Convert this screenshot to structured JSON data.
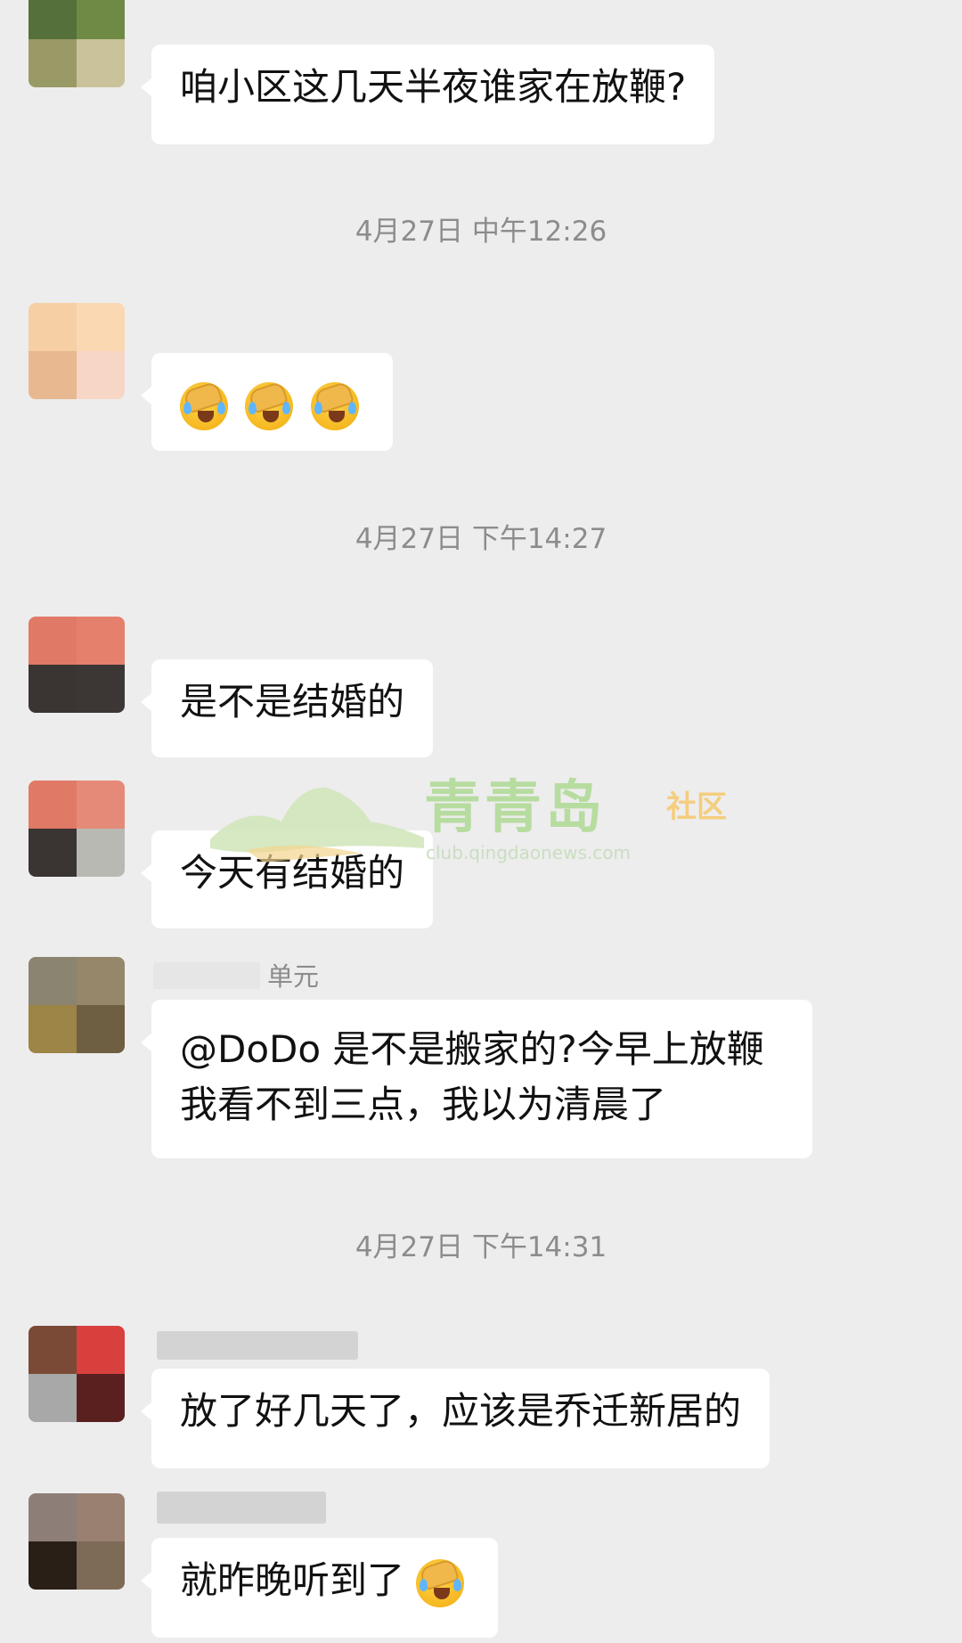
{
  "messages": [
    {
      "text": "咱小区这几天半夜谁家在放鞭?"
    },
    {
      "emoji_count": 3,
      "emoji_name": "crying-emoji"
    },
    {
      "text": "是不是结婚的"
    },
    {
      "text": "今天有结婚的"
    },
    {
      "text": "@DoDo  是不是搬家的?今早上放鞭我看不到三点，我以为清晨了",
      "sender_fragment": "单元"
    },
    {
      "text": "放了好几天了，应该是乔迁新居的"
    },
    {
      "text": "就昨晚听到了"
    }
  ],
  "timestamps": [
    "4月27日 中午12:26",
    "4月27日 下午14:27",
    "4月27日 下午14:31"
  ],
  "watermark": {
    "title": "青青岛",
    "subtitle": "社区",
    "url": "club.qingdaonews.com"
  },
  "colors": {
    "background": "#ededed",
    "bubble": "#ffffff",
    "timestamp": "#8c8c8c",
    "watermark_green": "#b7dca0",
    "watermark_orange": "#f4cd7e"
  }
}
